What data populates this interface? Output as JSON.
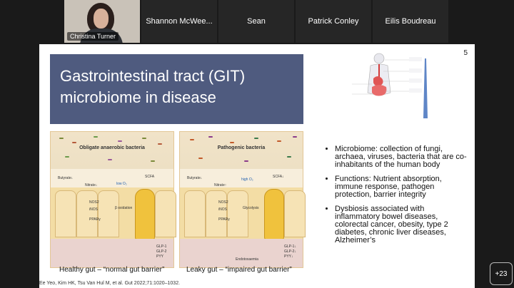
{
  "participants": [
    {
      "name": "Christina Turner"
    },
    {
      "name": "Shannon McWee..."
    },
    {
      "name": "Sean"
    },
    {
      "name": "Patrick Conley"
    },
    {
      "name": "Eilis Boudreau"
    }
  ],
  "more_participants": "+23",
  "slide": {
    "page_number": "5",
    "title_line1": "Gastrointestinal tract (GIT)",
    "title_line2": "microbiome in disease",
    "panel_left_title": "Obligate anaerobic bacteria",
    "panel_right_title": "Pathogenic bacteria",
    "caption_left": "Healthy gut – “normal gut barrier”",
    "caption_right": "Leaky gut – “impaired gut barrier”",
    "bullets": [
      "Microbiome: collection of fungi, archaea, viruses, bacteria that are co-inhabitants of the human body",
      "Functions: Nutrient absorption, immune response, pathogen protection, barrier integrity",
      "Dysbiosis associated with inflammatory bowel diseases, colorectal cancer, obesity, type 2 diabetes, chronic liver diseases, Alzheimer’s"
    ],
    "reference": "Ee Yeo, Kim HK, Tsu Van Hul M, et al. Gut 2022;71:1020–1032.",
    "left_labels": [
      "Butyrate↓",
      "Nitrate↓",
      "NOS2",
      "iNOS",
      "PPARγ",
      "low O₂",
      "β oxidation",
      "SCFA",
      "GLP-1",
      "GLP-2",
      "PYY"
    ],
    "right_labels": [
      "Butyrate↓",
      "Nitrate↑",
      "NOS2",
      "iNOS",
      "PPARγ",
      "high O₂",
      "Glycolysis",
      "SCFA↓",
      "GLP-1↓",
      "GLP-2↓",
      "PYY↓",
      "Endotoxaemia"
    ]
  }
}
